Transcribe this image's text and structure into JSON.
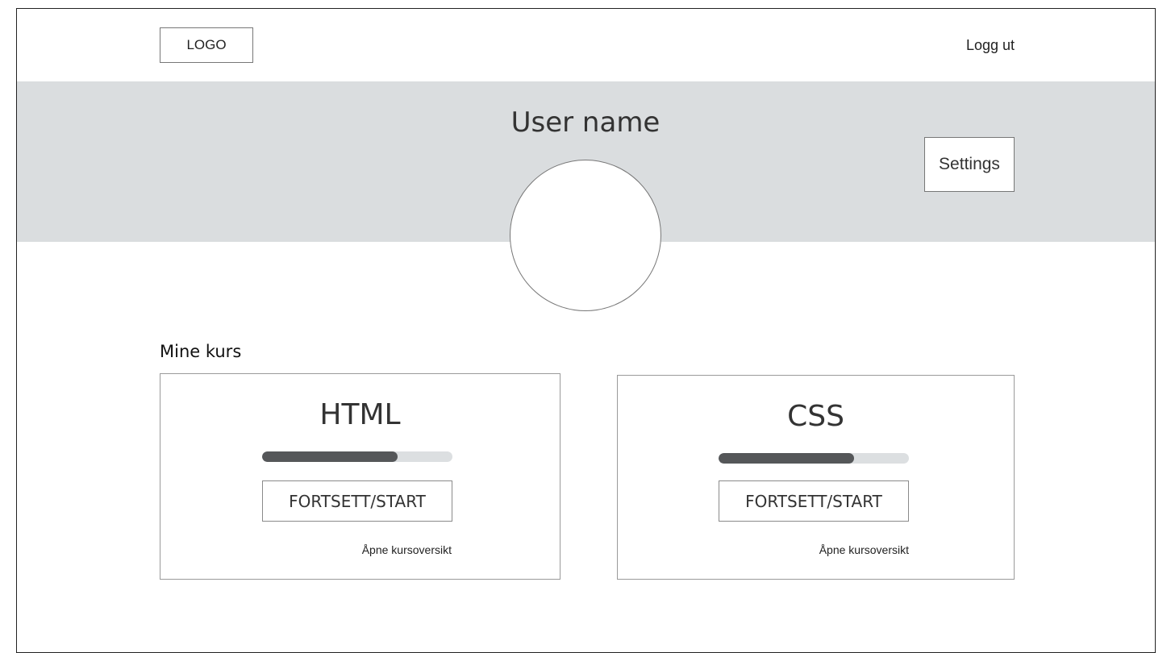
{
  "header": {
    "logo_label": "LOGO",
    "logout_label": "Logg ut"
  },
  "profile": {
    "username": "User name",
    "settings_label": "Settings"
  },
  "courses": {
    "section_title": "Mine kurs",
    "items": [
      {
        "title": "HTML",
        "progress": 0.71,
        "start_label": "FORTSETT/START",
        "overview_label": "Åpne kursoversikt"
      },
      {
        "title": "CSS",
        "progress": 0.71,
        "start_label": "FORTSETT/START",
        "overview_label": "Åpne kursoversikt"
      }
    ]
  },
  "colors": {
    "banner_bg": "#dadddf",
    "progress_track": "#dcdfe1",
    "progress_fill": "#555759"
  }
}
